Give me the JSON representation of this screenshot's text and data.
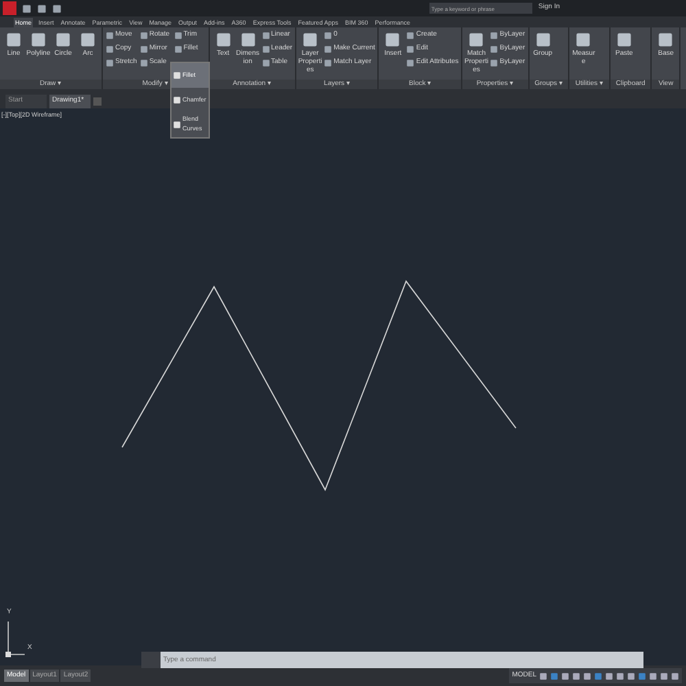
{
  "title_bar": {
    "search_placeholder": "Type a keyword or phrase",
    "sign_in": "Sign In"
  },
  "ribbon_tabs": [
    {
      "label": "Home",
      "selected": true
    },
    {
      "label": "Insert",
      "selected": false
    },
    {
      "label": "Annotate",
      "selected": false
    },
    {
      "label": "Parametric",
      "selected": false
    },
    {
      "label": "View",
      "selected": false
    },
    {
      "label": "Manage",
      "selected": false
    },
    {
      "label": "Output",
      "selected": false
    },
    {
      "label": "Add-ins",
      "selected": false
    },
    {
      "label": "A360",
      "selected": false
    },
    {
      "label": "Express Tools",
      "selected": false
    },
    {
      "label": "Featured Apps",
      "selected": false
    },
    {
      "label": "BIM 360",
      "selected": false
    },
    {
      "label": "Performance",
      "selected": false
    }
  ],
  "ribbon_groups": [
    {
      "label": "Draw",
      "menu_mark": "▾",
      "large": [
        "Line",
        "Polyline",
        "Circle",
        "Arc"
      ]
    },
    {
      "label": "Modify",
      "menu_mark": "▾",
      "small": [
        "Move",
        "Rotate",
        "Trim",
        "Copy",
        "Mirror",
        "Fillet",
        "Stretch",
        "Scale"
      ]
    },
    {
      "label": "Annotation",
      "menu_mark": "▾",
      "large": [
        "Text",
        "Dimension"
      ],
      "small": [
        "Linear",
        "Leader",
        "Table"
      ]
    },
    {
      "label": "Layers",
      "menu_mark": "▾",
      "large": [
        "Layer Properties"
      ],
      "small": [
        "0",
        "Make Current",
        "Match Layer"
      ]
    },
    {
      "label": "Block",
      "menu_mark": "▾",
      "large": [
        "Insert"
      ],
      "small": [
        "Create",
        "Edit",
        "Edit Attributes"
      ]
    },
    {
      "label": "Properties",
      "menu_mark": "▾",
      "large": [
        "Match Properties"
      ],
      "small": [
        "ByLayer",
        "ByLayer",
        "ByLayer"
      ]
    },
    {
      "label": "Groups",
      "menu_mark": "▾",
      "large": [
        "Group"
      ]
    },
    {
      "label": "Utilities",
      "menu_mark": "▾",
      "large": [
        "Measure"
      ]
    },
    {
      "label": "Clipboard",
      "large": [
        "Paste"
      ]
    },
    {
      "label": "View",
      "large": [
        "Base"
      ]
    }
  ],
  "fillet_menu": [
    {
      "label": "Fillet",
      "selected": true
    },
    {
      "label": "Chamfer",
      "selected": false
    },
    {
      "label": "Blend Curves",
      "selected": false
    }
  ],
  "file_tabs": [
    {
      "label": "Start",
      "selected": false
    },
    {
      "label": "Drawing1*",
      "selected": true
    }
  ],
  "viewport_label": "[-][Top][2D Wireframe]",
  "ucs": {
    "y": "Y",
    "x": "X"
  },
  "command_line": {
    "placeholder": "Type a command"
  },
  "layout_tabs": [
    {
      "label": "Model",
      "selected": true
    },
    {
      "label": "Layout1",
      "selected": false
    },
    {
      "label": "Layout2",
      "selected": false
    }
  ],
  "status_bar": {
    "space": "MODEL"
  }
}
